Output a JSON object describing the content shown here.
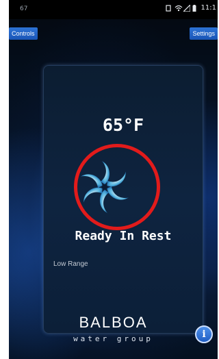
{
  "status_bar": {
    "left_text": "67",
    "time": "11:1",
    "icons": [
      "notification-icon",
      "wifi-icon",
      "signal-icon",
      "battery-icon"
    ]
  },
  "header": {
    "controls_label": "Controls",
    "settings_label": "Settings"
  },
  "main": {
    "temperature": "65°F",
    "status": "Ready In Rest",
    "range": "Low Range",
    "heater_icon": "spinning-fan-icon"
  },
  "footer": {
    "brand": "BALBOA",
    "brand_sub": "water group",
    "info_label": "i"
  },
  "colors": {
    "button_blue": "#1a55b6",
    "annotation_ring": "#e21b1b",
    "panel_bg": "#0e2440"
  }
}
